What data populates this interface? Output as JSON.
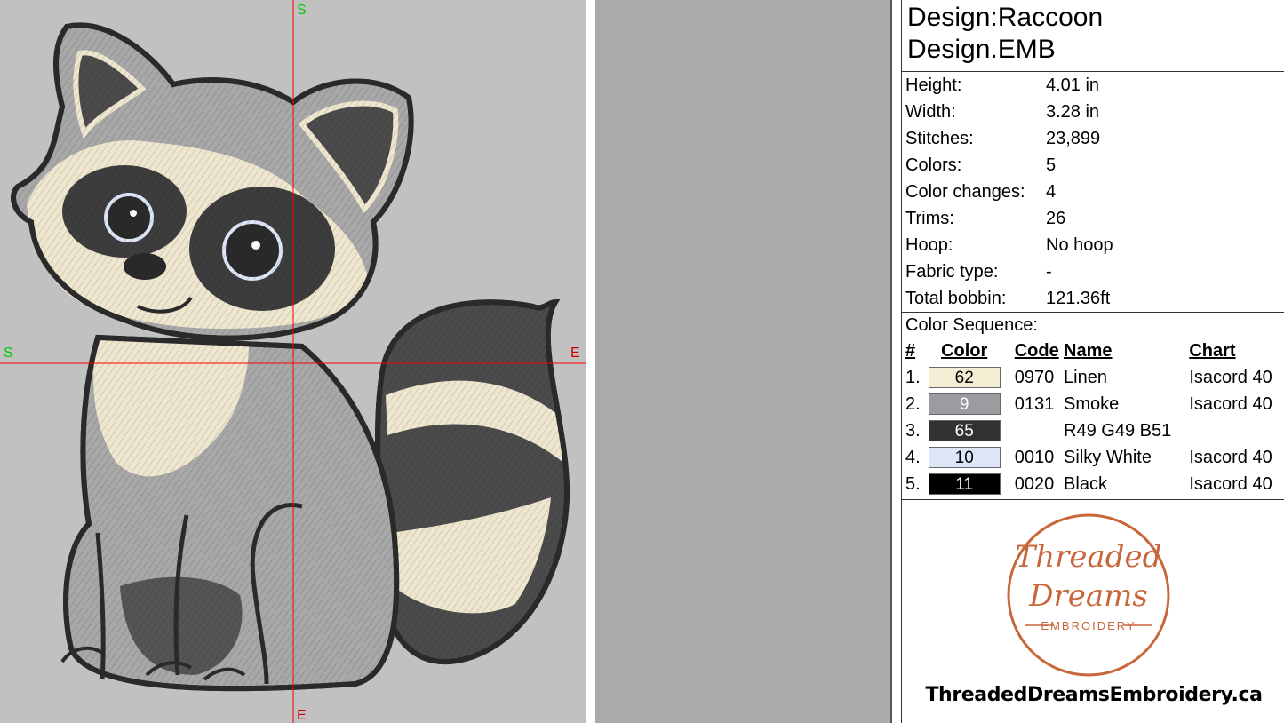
{
  "canvas": {
    "axis_start_top": "S",
    "axis_end_bottom": "E",
    "axis_start_left": "S",
    "axis_end_right": "E",
    "background": "#c1c1c1",
    "guide_color": "#ff0000",
    "axis_label_start_color": "#00cc00",
    "axis_label_end_color": "#cc0000"
  },
  "panel": {
    "title_line1": "Design:Raccoon",
    "title_line2": "Design.EMB",
    "stats": [
      {
        "label": "Height:",
        "value": "4.01 in"
      },
      {
        "label": "Width:",
        "value": "3.28 in"
      },
      {
        "label": "Stitches:",
        "value": "23,899"
      },
      {
        "label": "Colors:",
        "value": "5"
      },
      {
        "label": "Color changes:",
        "value": "4"
      },
      {
        "label": "Trims:",
        "value": "26"
      },
      {
        "label": "Hoop:",
        "value": "No hoop"
      },
      {
        "label": "Fabric type:",
        "value": "-"
      },
      {
        "label": "Total bobbin:",
        "value": "121.36ft"
      }
    ],
    "sequence_title": "Color Sequence:",
    "sequence_headers": {
      "num": "#",
      "color": "Color",
      "code": "Code",
      "name": "Name",
      "chart": "Chart"
    },
    "sequence": [
      {
        "num": "1.",
        "swatch": "62",
        "hex": "#f5ecd4",
        "text_color": "#000000",
        "code": "0970",
        "name": "Linen",
        "chart": "Isacord 40"
      },
      {
        "num": "2.",
        "swatch": "9",
        "hex": "#9a9c9f",
        "text_color": "#ffffff",
        "code": "0131",
        "name": "Smoke",
        "chart": "Isacord 40"
      },
      {
        "num": "3.",
        "swatch": "65",
        "hex": "#313133",
        "text_color": "#ffffff",
        "code": "",
        "name": "R49 G49 B51",
        "chart": ""
      },
      {
        "num": "4.",
        "swatch": "10",
        "hex": "#dde6f7",
        "text_color": "#000000",
        "code": "0010",
        "name": "Silky White",
        "chart": "Isacord 40"
      },
      {
        "num": "5.",
        "swatch": "11",
        "hex": "#000000",
        "text_color": "#ffffff",
        "code": "0020",
        "name": "Black",
        "chart": "Isacord 40"
      }
    ],
    "logo": {
      "line1": "Threaded",
      "line2": "Dreams",
      "line3": "EMBROIDERY",
      "color": "#c8673c"
    },
    "website": "ThreadedDreamsEmbroidery.ca"
  }
}
